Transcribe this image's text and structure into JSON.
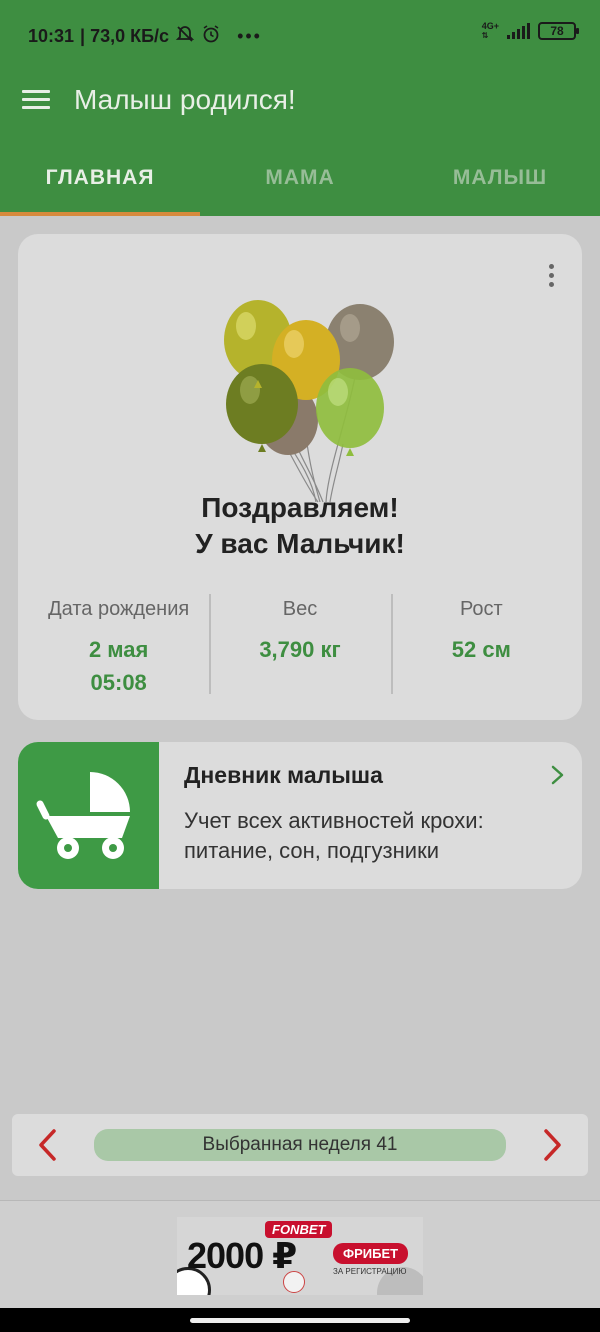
{
  "status_bar": {
    "time": "10:31",
    "network_speed": "| 73,0 КБ/с",
    "signal_label": "4G+",
    "battery": "78"
  },
  "app_bar": {
    "title": "Малыш родился!"
  },
  "tabs": [
    {
      "label": "ГЛАВНАЯ",
      "active": true
    },
    {
      "label": "МАМА",
      "active": false
    },
    {
      "label": "МАЛЫШ",
      "active": false
    }
  ],
  "congrats": {
    "line1": "Поздравляем!",
    "line2": "У вас Мальчик!",
    "stats": [
      {
        "label": "Дата рождения",
        "value_line1": "2 мая",
        "value_line2": "05:08"
      },
      {
        "label": "Вес",
        "value_line1": "3,790 кг",
        "value_line2": ""
      },
      {
        "label": "Рост",
        "value_line1": "52 см",
        "value_line2": ""
      }
    ]
  },
  "diary": {
    "title": "Дневник малыша",
    "description": "Учет всех активностей крохи: питание, сон, подгузники"
  },
  "week_selector": {
    "label": "Выбранная неделя 41"
  },
  "ad": {
    "brand": "FONBET",
    "amount": "2000 ₽",
    "pill": "ФРИБЕТ",
    "subtext": "ЗА РЕГИСТРАЦИЮ"
  },
  "colors": {
    "primary_green": "#3e8e41",
    "tab_indicator": "#d68a3c",
    "arrow_red": "#c62828",
    "ad_red": "#c8102e"
  }
}
